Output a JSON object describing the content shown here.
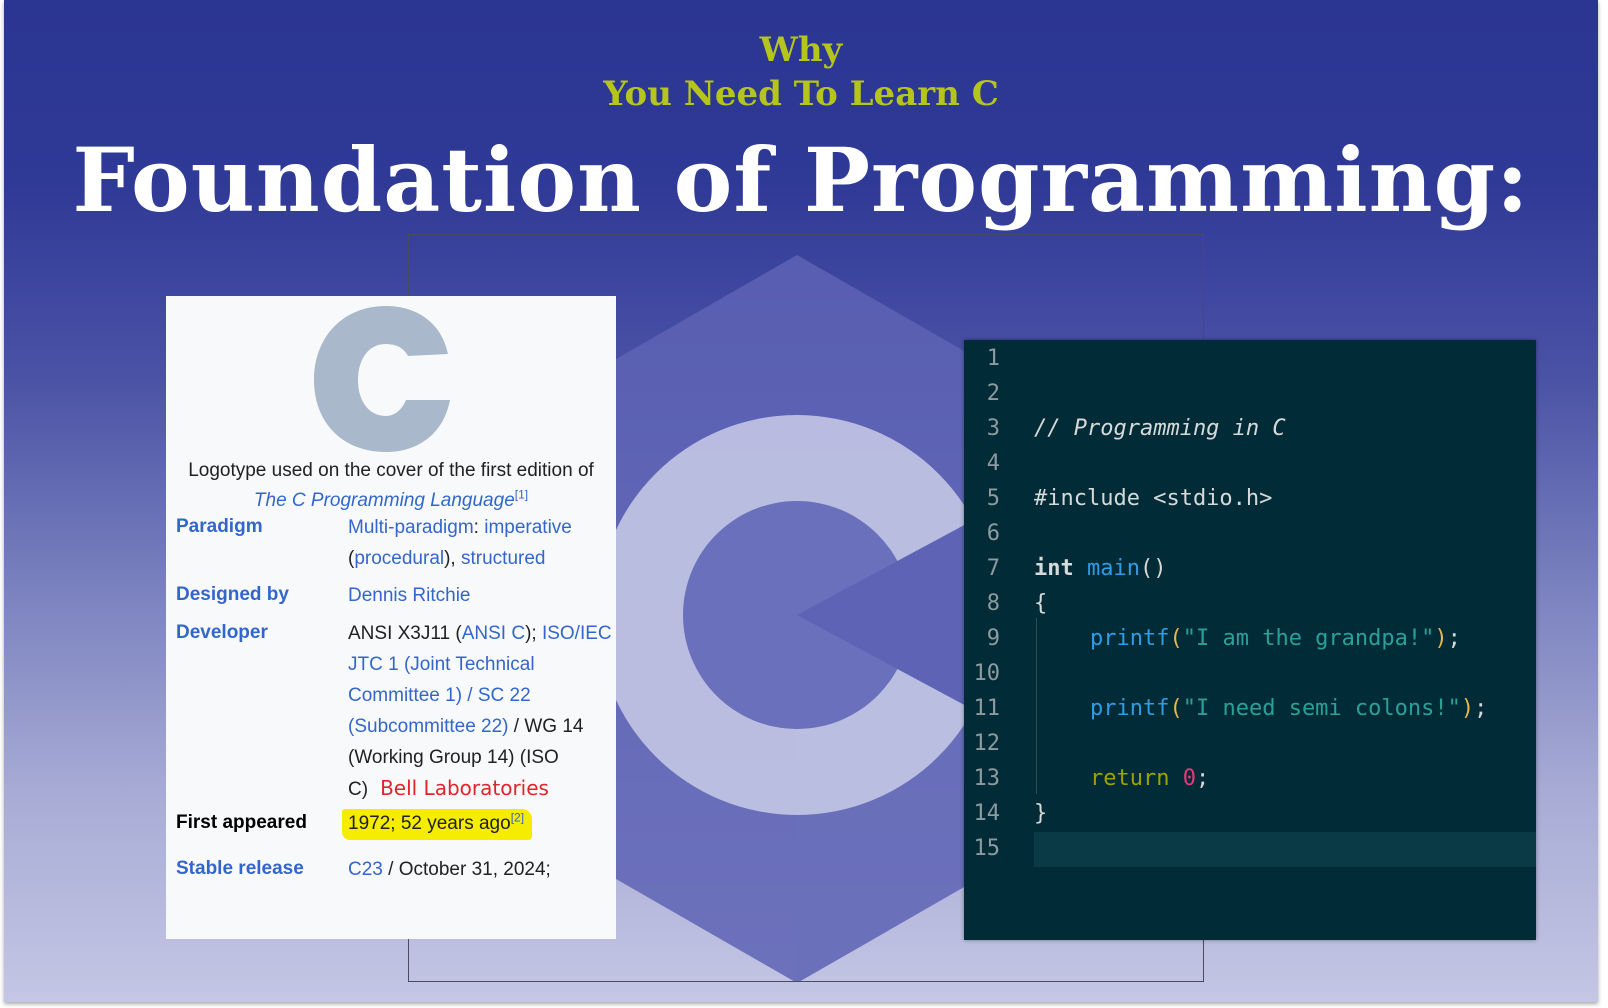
{
  "slide": {
    "why_line1": "Why",
    "why_line2": "You Need To Learn C",
    "title": "Foundation of Programming:"
  },
  "infobox": {
    "logo_letter": "C",
    "caption_text": "Logotype used on the cover of the first edition of",
    "caption_book": "The C Programming Language",
    "caption_ref": "[1]",
    "rows": {
      "paradigm_label": "Paradigm",
      "paradigm_link1": "Multi-paradigm",
      "paradigm_link2": "imperative",
      "paradigm_link3": "procedural",
      "paradigm_link4": "structured",
      "designed_label": "Designed by",
      "designed_value": "Dennis Ritchie",
      "developer_label": "Developer",
      "developer_text1": "ANSI X3J11 (",
      "developer_link1": "ANSI C",
      "developer_text2": ");",
      "developer_link2": "ISO/IEC JTC 1 (Joint Technical Committee 1) / SC 22 (Subcommittee 22)",
      "developer_text3": "/ WG 14 (Working Group 14) (ISO C)",
      "developer_annotation": "Bell Laboratories",
      "first_label": "First appeared",
      "first_value": "1972; 52 years ago",
      "first_ref": "[2]",
      "stable_label": "Stable release",
      "stable_link": "C23",
      "stable_value": "/ October 31, 2024;"
    }
  },
  "editor": {
    "line_numbers": [
      "1",
      "2",
      "3",
      "4",
      "5",
      "6",
      "7",
      "8",
      "9",
      "10",
      "11",
      "12",
      "13",
      "14",
      "15"
    ],
    "comment": "// Programming in C",
    "include": "#include <stdio.h>",
    "kw_int": "int",
    "fn_main": "main",
    "parens": "()",
    "brace_open": "{",
    "printf1": "printf",
    "str1": "\"I am the grandpa!\"",
    "printf2": "printf",
    "str2": "\"I need semi colons!\"",
    "ret": "return",
    "zero": "0",
    "semi": ";",
    "brace_close": "}"
  },
  "colors": {
    "background_top": "#2b3592",
    "background_bottom": "#c4c6e4",
    "why_text": "#b5c51c",
    "editor_bg": "#012b36",
    "link_blue": "#3366cc",
    "highlight": "#f5ec00",
    "annotation_red": "#e0242c"
  }
}
